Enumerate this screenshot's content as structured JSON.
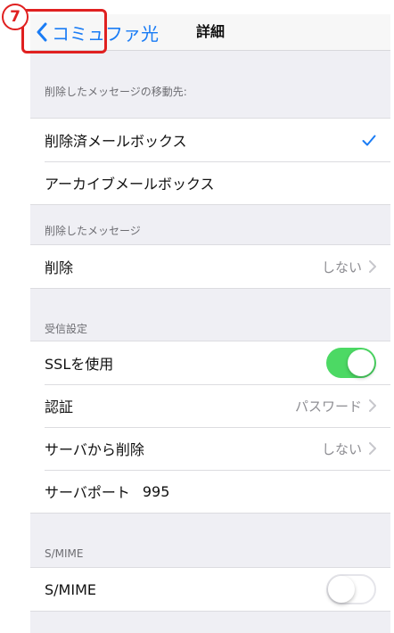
{
  "nav": {
    "back_label": "コミュファ光",
    "title": "詳細"
  },
  "annotation": {
    "step_number": "7"
  },
  "sections": {
    "deleted_move": {
      "header": "削除したメッセージの移動先:",
      "items": [
        "削除済メールボックス",
        "アーカイブメールボックス"
      ],
      "selected": "削除済メールボックス"
    },
    "deleted_messages": {
      "header": "削除したメッセージ",
      "delete_label": "削除",
      "delete_value": "しない"
    },
    "incoming": {
      "header": "受信設定",
      "ssl_label": "SSLを使用",
      "ssl_enabled": true,
      "auth_label": "認証",
      "auth_value": "パスワード",
      "server_delete_label": "サーバから削除",
      "server_delete_value": "しない",
      "port_label": "サーバポート",
      "port_value": "995"
    },
    "smime": {
      "header": "S/MIME",
      "smime_label": "S/MIME",
      "smime_enabled": false
    }
  },
  "colors": {
    "accent": "#1a7cf5",
    "toggle_on": "#4cd964",
    "annotation": "#e02020"
  }
}
